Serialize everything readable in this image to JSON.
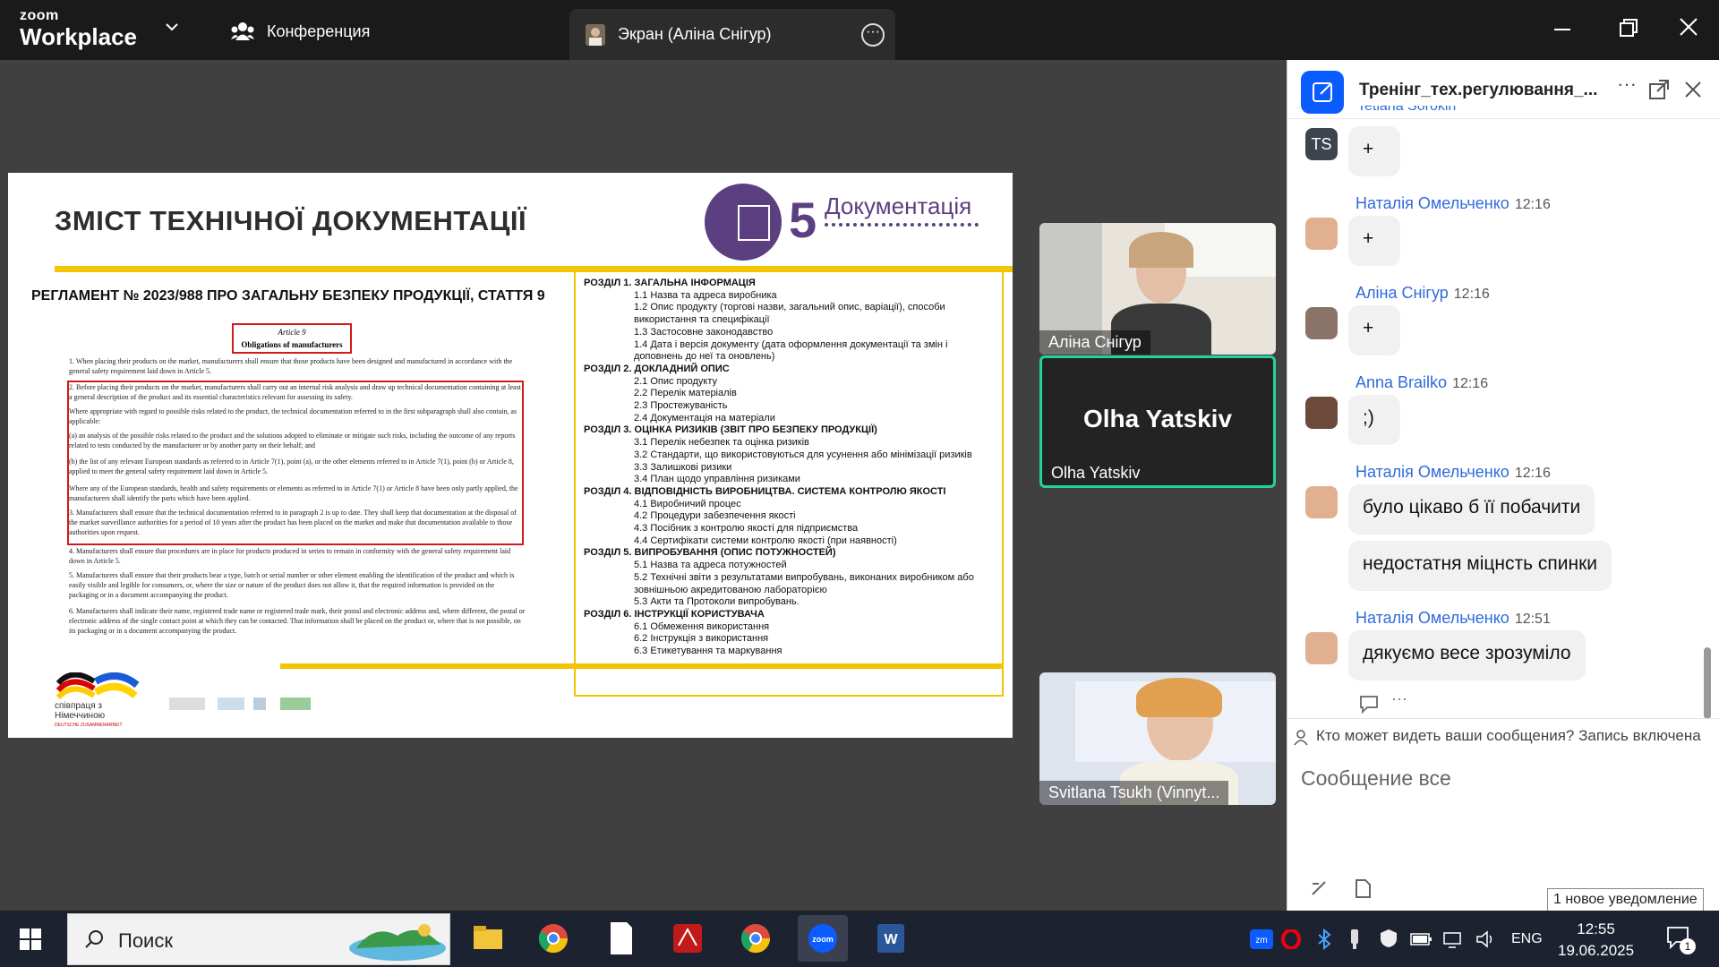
{
  "app": {
    "brand_top": "zoom",
    "brand_bottom": "Workplace",
    "conference_label": "Конференция",
    "screen_tab_label": "Экран (Аліна Снігур)"
  },
  "slide": {
    "title": "ЗМІСТ ТЕХНІЧНОЇ ДОКУМЕНТАЦІЇ",
    "badge_number": "5",
    "badge_label": "Документація",
    "regulation_heading": "РЕГЛАМЕНТ № 2023/988 ПРО ЗАГАЛЬНУ БЕЗПЕКУ ПРОДУКЦІЇ, СТАТТЯ 9",
    "article_number": "Article 9",
    "article_title": "Obligations of manufacturers",
    "paragraphs": [
      "1.   When placing their products on the market, manufacturers shall ensure that those products have been designed and manufactured in accordance with the general safety requirement laid down in Article 5.",
      "2.   Before placing their products on the market, manufacturers shall carry out an internal risk analysis and draw up technical documentation containing at least a general description of the product and its essential characteristics relevant for assessing its safety.",
      "Where appropriate with regard to possible risks related to the product, the technical documentation referred to in the first subparagraph shall also contain, as applicable:",
      "(a)   an analysis of the possible risks related to the product and the solutions adopted to eliminate or mitigate such risks, including the outcome of any reports related to tests conducted by the manufacturer or by another party on their behalf; and",
      "(b)   the list of any relevant European standards as referred to in Article 7(1), point (a), or the other elements referred to in Article 7(1), point (b) or Article 8, applied to meet the general safety requirement laid down in Article 5.",
      "Where any of the European standards, health and safety requirements or elements as referred to in Article 7(1) or Article 8 have been only partly applied, the manufacturers shall identify the parts which have been applied.",
      "3.   Manufacturers shall ensure that the technical documentation referred to in paragraph 2 is up to date. They shall keep that documentation at the disposal of the market surveillance authorities for a period of 10 years after the product has been placed on the market and make that documentation available to those authorities upon request.",
      "4.   Manufacturers shall ensure that procedures are in place for products produced in series to remain in conformity with the general safety requirement laid down in Article 5.",
      "5.   Manufacturers shall ensure that their products bear a type, batch or serial number or other element enabling the identification of the product and which is easily visible and legible for consumers, or, where the size or nature of the product does not allow it, that the required information is provided on the packaging or in a document accompanying the product.",
      "6.   Manufacturers shall indicate their name, registered trade name or registered trade mark, their postal and electronic address and, where different, the postal or electronic address of the single contact point at which they can be contacted. That information shall be placed on the product or, where that is not possible, on its packaging or in a document accompanying the product."
    ],
    "toc": [
      {
        "type": "h",
        "text": "РОЗДІЛ 1. ЗАГАЛЬНА ІНФОРМАЦІЯ"
      },
      {
        "type": "s",
        "text": "1.1 Назва та адреса виробника"
      },
      {
        "type": "s",
        "text": "1.2 Опис продукту (торгові назви, загальний опис, варіації), способи"
      },
      {
        "type": "s",
        "text": "використання та специфікації"
      },
      {
        "type": "s",
        "text": "1.3 Застосовне законодавство"
      },
      {
        "type": "s",
        "text": "1.4 Дата і версія документу (дата оформлення документації та змін і"
      },
      {
        "type": "s",
        "text": "доповнень до неї та оновлень)"
      },
      {
        "type": "h",
        "text": "РОЗДІЛ 2. ДОКЛАДНИЙ ОПИС"
      },
      {
        "type": "s",
        "text": "2.1 Опис продукту"
      },
      {
        "type": "s",
        "text": "2.2 Перелік матеріалів"
      },
      {
        "type": "s",
        "text": "2.3 Простежуваність"
      },
      {
        "type": "s",
        "text": "2.4 Документація на матеріали"
      },
      {
        "type": "h",
        "text": "РОЗДІЛ 3. ОЦІНКА РИЗИКІВ (ЗВІТ ПРО БЕЗПЕКУ ПРОДУКЦІЇ)"
      },
      {
        "type": "s",
        "text": "3.1  Перелік небезпек та оцінка ризиків"
      },
      {
        "type": "s",
        "text": "3.2  Стандарти, що використовуються для усунення або мінімізації ризиків"
      },
      {
        "type": "s",
        "text": "3.3  Залишкові ризики"
      },
      {
        "type": "s",
        "text": "3.4  План щодо управління ризиками"
      },
      {
        "type": "h",
        "text": "РОЗДІЛ 4. ВІДПОВІДНІСТЬ ВИРОБНИЦТВА. СИСТЕМА КОНТРОЛЮ ЯКОСТІ"
      },
      {
        "type": "s",
        "text": "4.1  Виробничий процес"
      },
      {
        "type": "s",
        "text": "4.2 Процедури забезпечення якості"
      },
      {
        "type": "s",
        "text": "4.3  Посібник з контролю якості для підприємства"
      },
      {
        "type": "s",
        "text": "4.4  Сертифікати системи контролю якості (при наявності)"
      },
      {
        "type": "h",
        "text": "РОЗДІЛ 5. ВИПРОБУВАННЯ (ОПИС ПОТУЖНОСТЕЙ)"
      },
      {
        "type": "s",
        "text": "5.1  Назва та адреса потужностей"
      },
      {
        "type": "s",
        "text": "5.2 Технічні звіти з результатами випробувань, виконаних виробником або"
      },
      {
        "type": "s",
        "text": "зовнішньою акредитованою лабораторією"
      },
      {
        "type": "s",
        "text": "5.3  Акти та Протоколи випробувань."
      },
      {
        "type": "h",
        "text": "РОЗДІЛ 6. ІНСТРУКЦІЇ КОРИСТУВАЧА"
      },
      {
        "type": "s",
        "text": "6.1  Обмеження використання"
      },
      {
        "type": "s",
        "text": "6.2  Інструкція з використання"
      },
      {
        "type": "s",
        "text": "6.3  Етикетування та маркування"
      }
    ],
    "partner_line1": "співпраця з",
    "partner_line2": "Німеччиною",
    "partner_line3": "DEUTSCHE ZUSAMMENARBEIT"
  },
  "participants": [
    {
      "name": "Аліна Снігур"
    },
    {
      "name": "Olha Yatskiv",
      "display": "Olha Yatskiv"
    },
    {
      "name": "Svitlana Tsukh (Vinnyt..."
    }
  ],
  "chat": {
    "title": "Тренінг_тех.регулювання_...",
    "partial_name": "Tetiana Sorokin",
    "messages": [
      {
        "initials": "TS",
        "text": "+"
      },
      {
        "author": "Наталія Омельченко",
        "time": "12:16",
        "text": "+"
      },
      {
        "author": "Аліна Снігур",
        "time": "12:16",
        "text": "+"
      },
      {
        "author": "Anna Brailko",
        "time": "12:16",
        "text": ";)"
      },
      {
        "author": "Наталія Омельченко",
        "time": "12:16",
        "text": "було цікаво б її побачити",
        "text2": "недостатня міцнсть спинки"
      },
      {
        "author": "Наталія Омельченко",
        "time": "12:51",
        "text": "дякуємо весе зрозуміло"
      }
    ],
    "visibility_notice": "Кто может видеть ваши сообщения? Запись включена",
    "compose_placeholder": "Сообщение все",
    "new_notification": "1 новое уведомление"
  },
  "taskbar": {
    "search_placeholder": "Поиск",
    "language": "ENG",
    "time": "12:55",
    "date": "19.06.2025",
    "notification_count": "1"
  }
}
